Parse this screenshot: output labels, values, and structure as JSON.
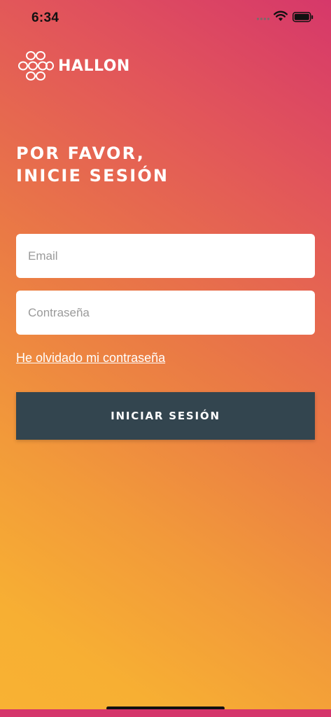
{
  "status_bar": {
    "time": "6:34",
    "icons": [
      "cellular-signal-icon",
      "wifi-icon",
      "battery-icon"
    ]
  },
  "brand": {
    "logo_text": "HALLON",
    "logo_icon": "hallon-cluster-icon"
  },
  "login": {
    "heading_line1": "POR FAVOR,",
    "heading_line2": "INICIE SESIÓN",
    "email_placeholder": "Email",
    "email_value": "",
    "password_placeholder": "Contraseña",
    "password_value": "",
    "forgot_link": "He olvidado mi contraseña",
    "submit_label": "INICIAR SESIÓN"
  },
  "colors": {
    "gradient_top_right": "#d6386a",
    "gradient_bottom_left": "#f8b233",
    "button_bg": "#33454f",
    "field_bg": "#ffffff",
    "text_on_bg": "#ffffff"
  }
}
